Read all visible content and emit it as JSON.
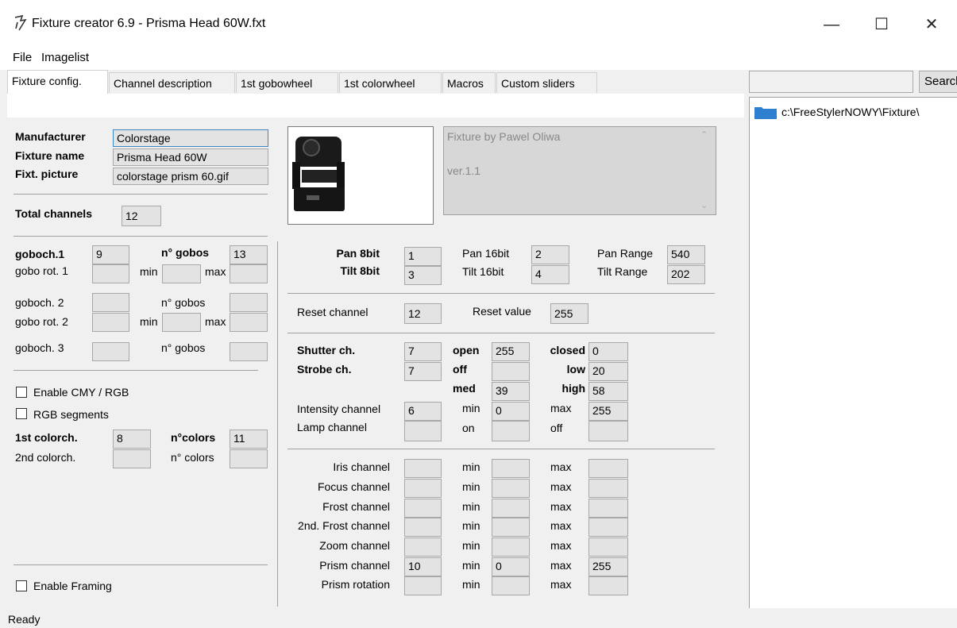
{
  "window": {
    "title": "Fixture creator 6.9 - Prisma Head 60W.fxt",
    "minimize": "—",
    "maximize": "☐",
    "close": "✕"
  },
  "menu": [
    "File",
    "Imagelist"
  ],
  "tabs": [
    "Fixture config.",
    "Channel description",
    "1st gobowheel",
    "1st colorwheel",
    "Macros",
    "Custom sliders"
  ],
  "search": {
    "value": "",
    "button": "Search"
  },
  "tree": {
    "path": "c:\\FreeStylerNOWY\\Fixture\\"
  },
  "fixture": {
    "manufacturer_label": "Manufacturer",
    "manufacturer": "Colorstage",
    "name_label": "Fixture name",
    "name": "Prisma Head 60W",
    "picture_label": "Fixt. picture",
    "picture": "colorstage prism 60.gif",
    "total_label": "Total channels",
    "total": "12",
    "notes_line1": "Fixture by Pawel Oliwa",
    "notes_line2": "ver.1.1"
  },
  "gobo": {
    "goboch1_label": "goboch.1",
    "goboch1": "9",
    "ngobos1_label": "n° gobos",
    "ngobos1": "13",
    "gorot1_label": "gobo rot. 1",
    "min": "min",
    "max": "max",
    "goboch2_label": "goboch. 2",
    "ngobos2_label": "n° gobos",
    "gorot2_label": "gobo rot. 2",
    "goboch3_label": "goboch. 3",
    "ngobos3_label": "n° gobos"
  },
  "color": {
    "enable_cmy": "Enable CMY / RGB",
    "rgb_segments": "RGB segments",
    "colorch1_label": "1st colorch.",
    "colorch1": "8",
    "ncolors1_label": "n°colors",
    "ncolors1": "11",
    "colorch2_label": "2nd colorch.",
    "ncolors2_label": "n° colors",
    "enable_framing": "Enable Framing"
  },
  "pantilt": {
    "pan8_label": "Pan 8bit",
    "pan8": "1",
    "tilt8_label": "Tilt 8bit",
    "tilt8": "3",
    "pan16_label": "Pan 16bit",
    "pan16": "2",
    "tilt16_label": "Tilt 16bit",
    "tilt16": "4",
    "panrange_label": "Pan Range",
    "panrange": "540",
    "tiltrange_label": "Tilt Range",
    "tiltrange": "202"
  },
  "reset": {
    "channel_label": "Reset channel",
    "channel": "12",
    "value_label": "Reset value",
    "value": "255"
  },
  "shutter": {
    "shutter_label": "Shutter ch.",
    "shutter": "7",
    "strobe_label": "Strobe ch.",
    "strobe": "7",
    "open_label": "open",
    "open": "255",
    "closed_label": "closed",
    "closed": "0",
    "off_label": "off",
    "off": "",
    "low_label": "low",
    "low": "20",
    "med_label": "med",
    "med": "39",
    "high_label": "high",
    "high": "58",
    "intensity_label": "Intensity channel",
    "intensity": "6",
    "int_min_label": "min",
    "int_min": "0",
    "int_max_label": "max",
    "int_max": "255",
    "lamp_label": "Lamp channel",
    "lamp_on_label": "on",
    "lamp_off_label": "off"
  },
  "optics": [
    {
      "label": "Iris channel",
      "ch": "",
      "min": "",
      "max": ""
    },
    {
      "label": "Focus channel",
      "ch": "",
      "min": "",
      "max": ""
    },
    {
      "label": "Frost channel",
      "ch": "",
      "min": "",
      "max": ""
    },
    {
      "label": "2nd. Frost channel",
      "ch": "",
      "min": "",
      "max": ""
    },
    {
      "label": "Zoom channel",
      "ch": "",
      "min": "",
      "max": ""
    },
    {
      "label": "Prism channel",
      "ch": "10",
      "min": "0",
      "max": "255"
    },
    {
      "label": "Prism rotation",
      "ch": "",
      "min": "",
      "max": ""
    }
  ],
  "optics_min_label": "min",
  "optics_max_label": "max",
  "status": "Ready",
  "colors": {
    "folder": "#2f7fd0",
    "selection_border": "#3d86c6"
  }
}
